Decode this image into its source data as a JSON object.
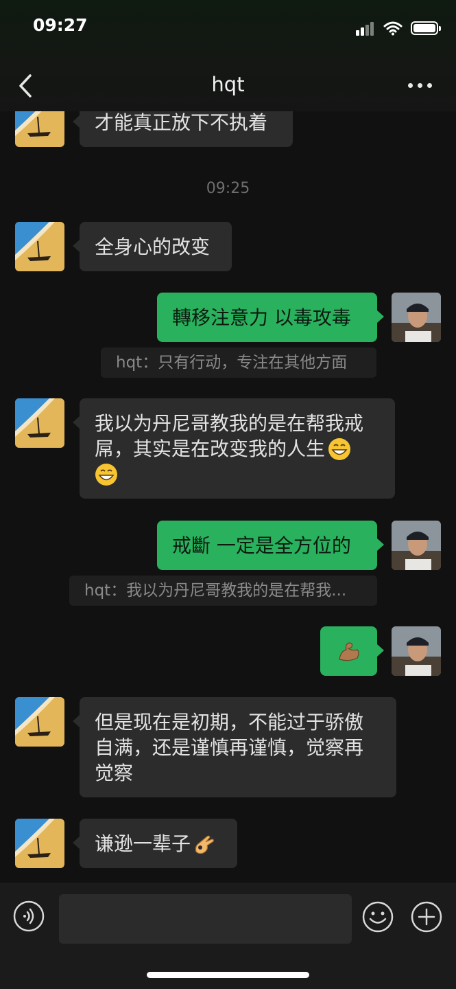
{
  "status_bar": {
    "time": "09:27"
  },
  "nav": {
    "title": "hqt"
  },
  "messages": {
    "m1": "才能真正放下不执着",
    "ts1": "09:25",
    "m2": "全身心的改变",
    "m3": "轉移注意力 以毒攻毒",
    "q3": "hqt：只有行动，专注在其他方面",
    "m4_l1": "我以为丹尼哥教我的是在帮我戒",
    "m4_l2": "屌，其实是在改变我的人生",
    "m5": "戒斷 一定是全方位的",
    "q5": "hqt：我以为丹尼哥教我的是在帮我...",
    "m7_l1": "但是现在是初期，不能过于骄傲",
    "m7_l2": "自满，还是谨慎再谨慎，觉察再",
    "m7_l3": "觉察",
    "m8": "谦逊一辈子"
  },
  "icons": {
    "emoji_grin": "grinning-face-emoji",
    "emoji_muscle": "flexed-biceps-emoji",
    "emoji_ok": "ok-hand-emoji"
  },
  "colors": {
    "sent_bubble": "#29b15d",
    "received_bubble": "#2c2c2c",
    "background": "#111111"
  }
}
